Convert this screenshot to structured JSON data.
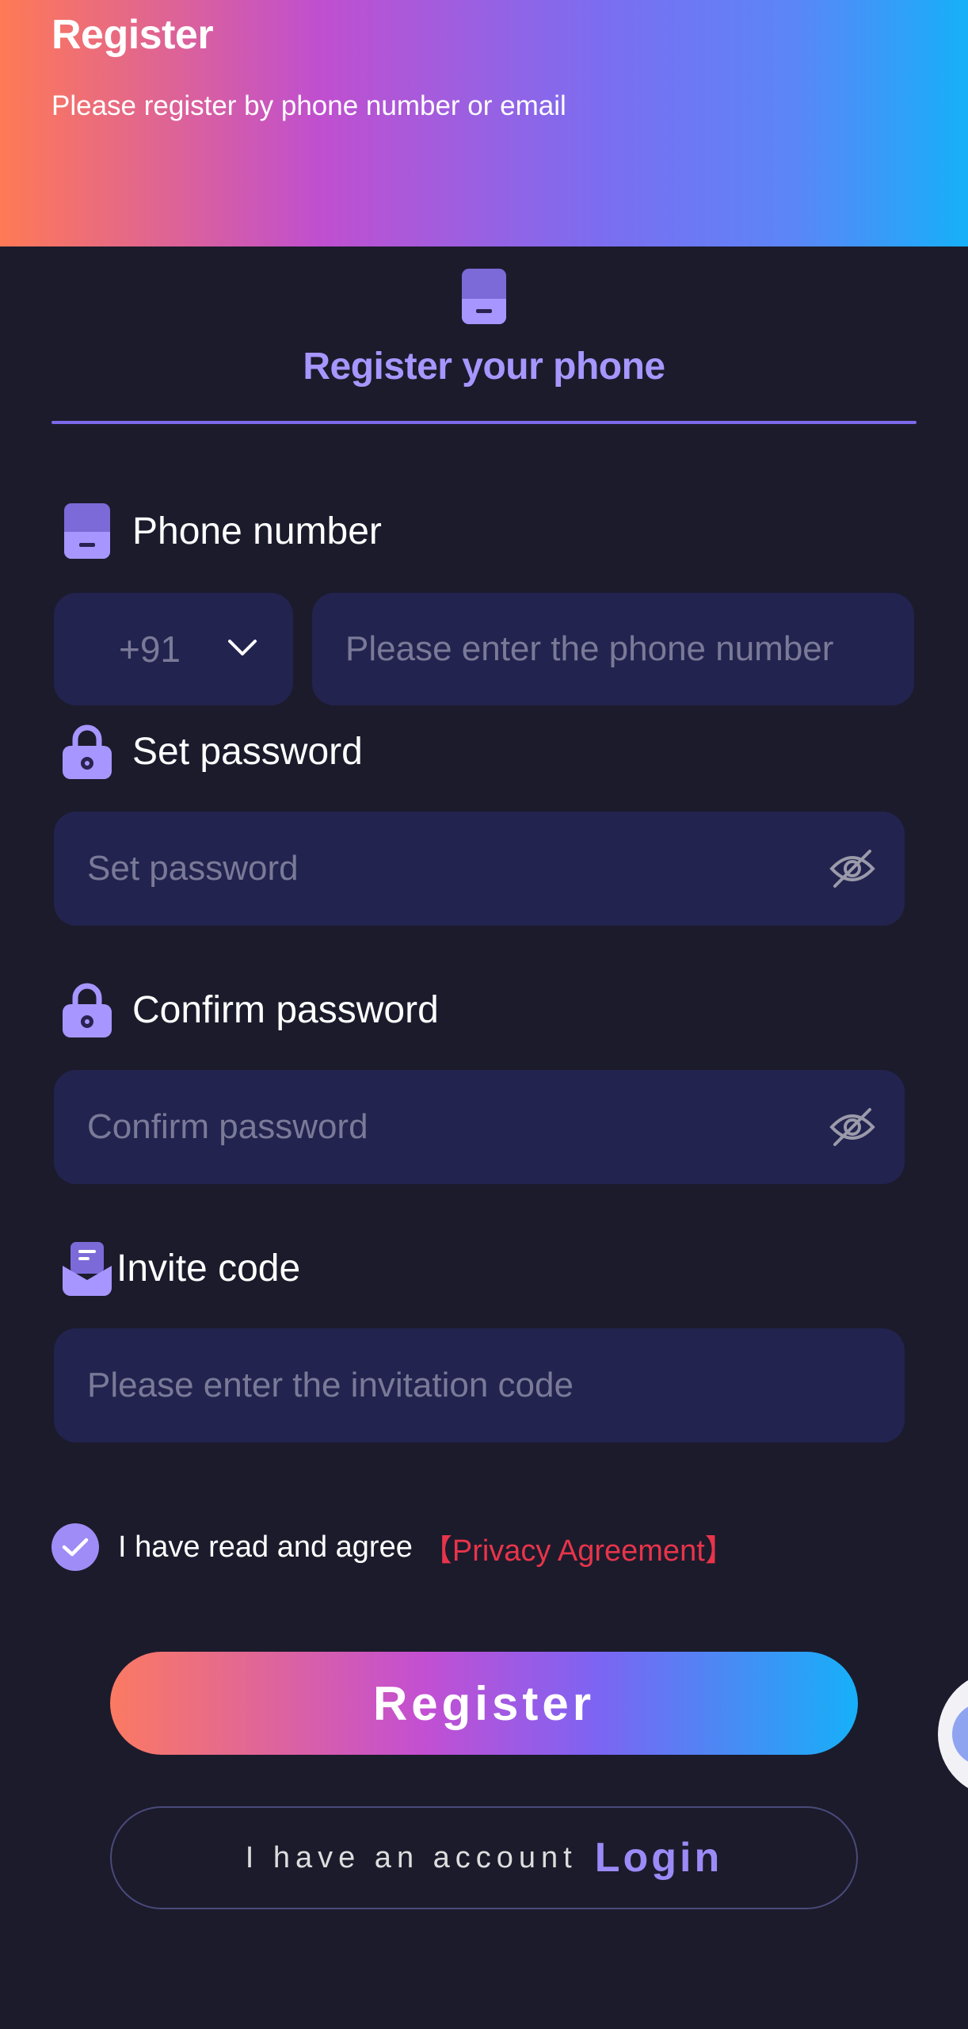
{
  "header": {
    "title": "Register",
    "subtitle": "Please register by phone number or email"
  },
  "tab": {
    "label": "Register your phone",
    "icon": "phone-icon"
  },
  "phone": {
    "label": "Phone number",
    "icon": "phone-icon",
    "country_code": "+91",
    "placeholder": "Please enter the phone number"
  },
  "password": {
    "label": "Set password",
    "icon": "lock-icon",
    "placeholder": "Set password"
  },
  "confirm": {
    "label": "Confirm password",
    "icon": "lock-icon",
    "placeholder": "Confirm password"
  },
  "invite": {
    "label": "Invite code",
    "icon": "invite-icon",
    "placeholder": "Please enter the invitation code"
  },
  "agreement": {
    "checked": true,
    "text": "I have read and agree",
    "link": "【Privacy Agreement】"
  },
  "buttons": {
    "register": "Register",
    "have_account": "I have an account",
    "login": "Login"
  },
  "colors": {
    "accent": "#a796ff",
    "field_bg": "#23234f",
    "page_bg": "#1b1b2c",
    "link": "#e8344a"
  }
}
